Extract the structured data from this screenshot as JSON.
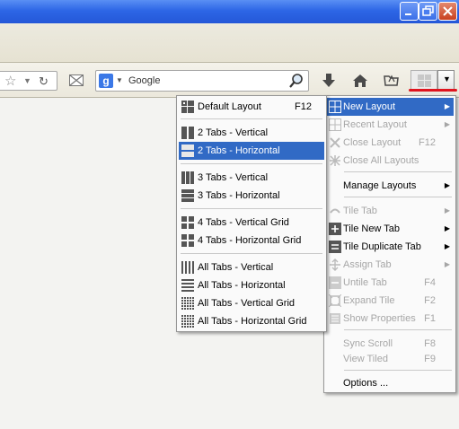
{
  "window": {
    "controls": [
      "minimize-icon",
      "maximize-icon",
      "close-icon"
    ]
  },
  "search": {
    "engine_icon": "google-icon",
    "text": "Google"
  },
  "toolbar_icons": [
    "star-icon",
    "reload-icon",
    "mail-icon",
    "download-icon",
    "home-icon",
    "bookmarks-icon",
    "tile-layout-icon"
  ],
  "colors": {
    "highlight": "#316ac5",
    "underline": "#e0141e",
    "titlebar": "#2d66e6"
  },
  "main_menu": {
    "new_layout": "New Layout",
    "recent_layout": "Recent Layout",
    "close_layout": "Close Layout",
    "close_layout_shortcut": "F12",
    "close_all_layouts": "Close All Layouts",
    "manage_layouts": "Manage Layouts",
    "tile_tab": "Tile Tab",
    "tile_new_tab": "Tile New Tab",
    "tile_duplicate_tab": "Tile Duplicate Tab",
    "assign_tab": "Assign Tab",
    "untile_tab": "Untile Tab",
    "untile_tab_shortcut": "F4",
    "expand_tile": "Expand Tile",
    "expand_tile_shortcut": "F2",
    "show_properties": "Show Properties",
    "show_properties_shortcut": "F1",
    "sync_scroll": "Sync Scroll",
    "sync_scroll_shortcut": "F8",
    "view_tiled": "View Tiled",
    "view_tiled_shortcut": "F9",
    "options": "Options ..."
  },
  "layout_menu": {
    "default_layout": "Default Layout",
    "default_layout_shortcut": "F12",
    "two_vertical": "2 Tabs - Vertical",
    "two_horizontal": "2 Tabs - Horizontal",
    "three_vertical": "3 Tabs - Vertical",
    "three_horizontal": "3 Tabs - Horizontal",
    "four_vertical_grid": "4 Tabs - Vertical Grid",
    "four_horizontal_grid": "4 Tabs - Horizontal Grid",
    "all_vertical": "All Tabs - Vertical",
    "all_horizontal": "All Tabs - Horizontal",
    "all_vertical_grid": "All Tabs - Vertical Grid",
    "all_horizontal_grid": "All Tabs - Horizontal Grid"
  }
}
